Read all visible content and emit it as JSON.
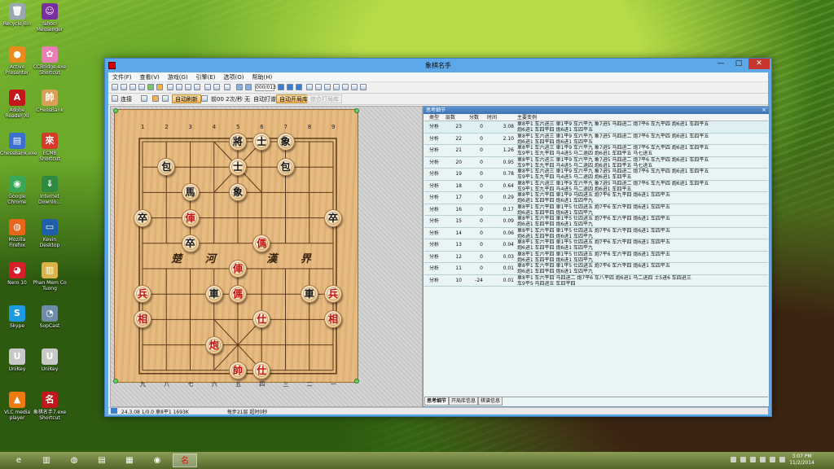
{
  "desktop": {
    "icons": [
      {
        "label": "Recycle Bin",
        "glyph": "🗑",
        "color": "#9aa7b3",
        "icon": "recycle-bin-icon"
      },
      {
        "label": "Yahoo! Messenger",
        "glyph": "☺",
        "color": "#7a2fa0",
        "icon": "yahoo-messenger-icon"
      },
      {
        "label": "Active Presenter",
        "glyph": "●",
        "color": "#e98b1d",
        "icon": "active-presenter-icon"
      },
      {
        "label": "CCBridge.exe Shortcut",
        "glyph": "✿",
        "color": "#e87fb7",
        "icon": "ccbridge-icon"
      },
      {
        "label": "Adobe Reader XI",
        "glyph": "A",
        "color": "#c4171c",
        "icon": "adobe-reader-icon"
      },
      {
        "label": "CHessBank",
        "glyph": "帥",
        "color": "#d9a05a",
        "icon": "chessbank-icon"
      },
      {
        "label": "ChessBank.exe",
        "glyph": "▤",
        "color": "#3a6fd0",
        "icon": "chessbank-exe-icon"
      },
      {
        "label": "ECMB Shortcut",
        "glyph": "來",
        "color": "#d63a2a",
        "icon": "ecmb-icon"
      },
      {
        "label": "Google Chrome",
        "glyph": "◉",
        "color": "#3aa757",
        "icon": "chrome-icon"
      },
      {
        "label": "Internet Downlo...",
        "glyph": "⇓",
        "color": "#2e8a3e",
        "icon": "idm-icon"
      },
      {
        "label": "Mozilla Firefox",
        "glyph": "◍",
        "color": "#e8661c",
        "icon": "firefox-icon"
      },
      {
        "label": "Kevin Desktop",
        "glyph": "▭",
        "color": "#1f5fa8",
        "icon": "kevin-desktop-icon"
      },
      {
        "label": "Nero 10",
        "glyph": "◕",
        "color": "#d61f2b",
        "icon": "nero-icon"
      },
      {
        "label": "Phan Mem Co Tuong",
        "glyph": "▥",
        "color": "#d9b24a",
        "icon": "folder-icon"
      },
      {
        "label": "Skype",
        "glyph": "S",
        "color": "#1d9be0",
        "icon": "skype-icon"
      },
      {
        "label": "SopCast",
        "glyph": "◔",
        "color": "#6f8ca8",
        "icon": "sopcast-icon"
      },
      {
        "label": "UniKey",
        "glyph": "U",
        "color": "#c8c8c8",
        "icon": "unikey-icon"
      },
      {
        "label": "UniKey",
        "glyph": "U",
        "color": "#c8c8c8",
        "icon": "unikey-icon"
      },
      {
        "label": "VLC media player",
        "glyph": "▲",
        "color": "#ee7a12",
        "icon": "vlc-icon"
      },
      {
        "label": "象棋名手7.exe Shortcut",
        "glyph": "名",
        "color": "#c4171c",
        "icon": "xiangqi-icon"
      }
    ]
  },
  "window": {
    "title": "象棋名手",
    "minimize": "—",
    "maximize": "□",
    "close": "✕",
    "menu": [
      "文件(F)",
      "查看(V)",
      "游戏(G)",
      "引擎(E)",
      "选项(O)",
      "帮助(H)"
    ],
    "toolbar": {
      "counter": "000/013",
      "connect": "连接",
      "btn_auto_refresh": "自动刷新",
      "think_info": "前00 2次/秒 无",
      "auto_play": "自动打谱",
      "btn_auto_open": "自动开局库",
      "btn_disabled": "综合打局库"
    }
  },
  "board": {
    "file_numbers_top": [
      "1",
      "2",
      "3",
      "4",
      "5",
      "6",
      "7",
      "8",
      "9"
    ],
    "file_numbers_bottom": [
      "九",
      "八",
      "七",
      "六",
      "五",
      "四",
      "三",
      "二",
      "一"
    ],
    "river_left": "楚 河",
    "river_right": "漢 界",
    "pieces": [
      {
        "t": "將",
        "c": "black",
        "f": 4,
        "r": 0
      },
      {
        "t": "士",
        "c": "black",
        "f": 5,
        "r": 0
      },
      {
        "t": "象",
        "c": "black",
        "f": 6,
        "r": 0
      },
      {
        "t": "士",
        "c": "black",
        "f": 4,
        "r": 1
      },
      {
        "t": "包",
        "c": "black",
        "f": 1,
        "r": 1
      },
      {
        "t": "包",
        "c": "black",
        "f": 6,
        "r": 1
      },
      {
        "t": "馬",
        "c": "black",
        "f": 2,
        "r": 2
      },
      {
        "t": "象",
        "c": "black",
        "f": 4,
        "r": 2
      },
      {
        "t": "卒",
        "c": "black",
        "f": 0,
        "r": 3
      },
      {
        "t": "俥",
        "c": "red",
        "f": 2,
        "r": 3
      },
      {
        "t": "卒",
        "c": "black",
        "f": 8,
        "r": 3
      },
      {
        "t": "卒",
        "c": "black",
        "f": 2,
        "r": 4
      },
      {
        "t": "傌",
        "c": "red",
        "f": 5,
        "r": 4
      },
      {
        "t": "俥",
        "c": "red",
        "f": 4,
        "r": 5
      },
      {
        "t": "兵",
        "c": "red",
        "f": 0,
        "r": 6
      },
      {
        "t": "車",
        "c": "black",
        "f": 3,
        "r": 6
      },
      {
        "t": "傌",
        "c": "red",
        "f": 4,
        "r": 6
      },
      {
        "t": "車",
        "c": "black",
        "f": 7,
        "r": 6
      },
      {
        "t": "兵",
        "c": "red",
        "f": 8,
        "r": 6
      },
      {
        "t": "相",
        "c": "red",
        "f": 0,
        "r": 7
      },
      {
        "t": "仕",
        "c": "red",
        "f": 5,
        "r": 7
      },
      {
        "t": "相",
        "c": "red",
        "f": 8,
        "r": 7
      },
      {
        "t": "炮",
        "c": "red",
        "f": 3,
        "r": 8
      },
      {
        "t": "帥",
        "c": "red",
        "f": 4,
        "r": 9
      },
      {
        "t": "仕",
        "c": "red",
        "f": 5,
        "r": 9
      }
    ]
  },
  "panel": {
    "title": "思考细节",
    "close": "×",
    "columns": [
      "类型",
      "层数",
      "分数",
      "时间",
      "主要变例"
    ],
    "rows": [
      {
        "type": "分析",
        "depth": "23",
        "score": "0",
        "time": "3.08",
        "pv": [
          "車8平1 车六进三 車1平9 车六平九 象7进5 马四进二 炮7平6 车九平四 炮6进1 车四平五",
          "炮6进1 车四平四 炮6进1 车四平五"
        ]
      },
      {
        "type": "分析",
        "depth": "22",
        "score": "0",
        "time": "2.10",
        "pv": [
          "車8平1 车六进三 車1平9 车六平九 象7进5 马四进二 炮7平6 车九平四 炮6进1 车四平五",
          "炮6进1 车四平四 炮6进1 车四平五"
        ]
      },
      {
        "type": "分析",
        "depth": "21",
        "score": "0",
        "time": "1.26",
        "pv": [
          "車8平1 车六进三 車1平9 车六平九 象7进5 马四进二 炮7平6 车九平四 炮6进1 车四平五",
          "车9平1 车九平四 马4进5 马二退四 炮6进1 车四平五 马七进五"
        ]
      },
      {
        "type": "分析",
        "depth": "20",
        "score": "0",
        "time": "0.95",
        "pv": [
          "車8平1 车六进三 車1平9 车六平九 象7进5 马四进二 炮7平6 车九平四 炮6进1 车四平五",
          "车9平1 车九平四 马4进5 马二退四 炮6进1 车四平五 马七进五"
        ]
      },
      {
        "type": "分析",
        "depth": "19",
        "score": "0",
        "time": "0.78",
        "pv": [
          "車8平1 车六进三 車1平9 车六平九 象7进5 马四进二 炮7平6 车九平四 炮6进1 车四平五",
          "车9平1 车九平四 马4进5 马二退四 炮6进1 车四平五"
        ]
      },
      {
        "type": "分析",
        "depth": "18",
        "score": "0",
        "time": "0.64",
        "pv": [
          "車8平1 车六进三 車1平9 车六平九 象7进5 马四进二 炮7平6 车九平四 炮6进1 车四平五",
          "车9平1 车九平四 马4进5 马二退四 炮6进1 车四平五"
        ]
      },
      {
        "type": "分析",
        "depth": "17",
        "score": "0",
        "time": "0.29",
        "pv": [
          "車8平1 车六平四 車1平9 马四进五 炮7平6 车九平四 炮6进1 车四平五",
          "炮6进1 车四平四 炮6进1 车四平九"
        ]
      },
      {
        "type": "分析",
        "depth": "16",
        "score": "0",
        "time": "0.17",
        "pv": [
          "車8平1 车六平四 車1平5 仕四进五 炮7平6 车六平四 炮6进1 车四平五",
          "炮6进1 车四平四 炮6进1 车四平九"
        ]
      },
      {
        "type": "分析",
        "depth": "15",
        "score": "0",
        "time": "0.09",
        "pv": [
          "車8平1 车六平四 車1平5 仕四进五 炮7平6 车六平四 炮6进1 车四平五",
          "炮6进1 车四平四 炮6进1 车四平九"
        ]
      },
      {
        "type": "分析",
        "depth": "14",
        "score": "0",
        "time": "0.06",
        "pv": [
          "車8平1 车六平四 車1平5 仕四进五 炮7平6 车六平四 炮6进1 车四平五",
          "炮6进1 车四平四 炮6进1 车四平九"
        ]
      },
      {
        "type": "分析",
        "depth": "13",
        "score": "0",
        "time": "0.04",
        "pv": [
          "車8平1 车六平四 車1平5 仕四进五 炮7平6 车六平四 炮6进1 车四平五",
          "炮6进1 车四平四 炮6进1 车四平九"
        ]
      },
      {
        "type": "分析",
        "depth": "12",
        "score": "0",
        "time": "0.03",
        "pv": [
          "車8平1 车六平四 車1平5 仕四进五 炮7平6 车六平四 炮6进1 车四平五",
          "炮6进1 车四平四 炮6进1 车四平九"
        ]
      },
      {
        "type": "分析",
        "depth": "11",
        "score": "0",
        "time": "0.01",
        "pv": [
          "車8平1 车六平四 車1平5 仕四进五 炮7平6 车六平四 炮6进1 车四平五",
          "炮6进1 车四平四 炮6进1 车四平九"
        ]
      },
      {
        "type": "分析",
        "depth": "10",
        "score": "-24",
        "score_neg": true,
        "time": "0.01",
        "pv": [
          "車8平1 车六平四 马四进二 炮7平6 车八平四 炮6进1 马二进四 士5进6 车四进三",
          "车9平5 马四进五 车四平四"
        ]
      }
    ],
    "tabs": [
      "思考细节",
      "开局库信息",
      "棋谱信息"
    ]
  },
  "status": {
    "text1": "24.3.08 1/0.0 車8平1 1693K",
    "text2": "每步21层 超时0秒"
  },
  "taskbar": {
    "clock_time": "3:07 PM",
    "clock_date": "11/2/2014",
    "apps": [
      {
        "glyph": "e",
        "icon": "ie-icon",
        "active": false
      },
      {
        "glyph": "▥",
        "icon": "explorer-icon",
        "active": false
      },
      {
        "glyph": "◍",
        "icon": "firefox-taskbar-icon",
        "active": false
      },
      {
        "glyph": "▤",
        "icon": "folder-taskbar-icon",
        "active": false
      },
      {
        "glyph": "▦",
        "icon": "notepad-taskbar-icon",
        "active": false
      },
      {
        "glyph": "◉",
        "icon": "chrome-taskbar-icon",
        "active": false
      },
      {
        "glyph": "名",
        "icon": "xiangqi-taskbar-icon",
        "active": true
      }
    ]
  }
}
